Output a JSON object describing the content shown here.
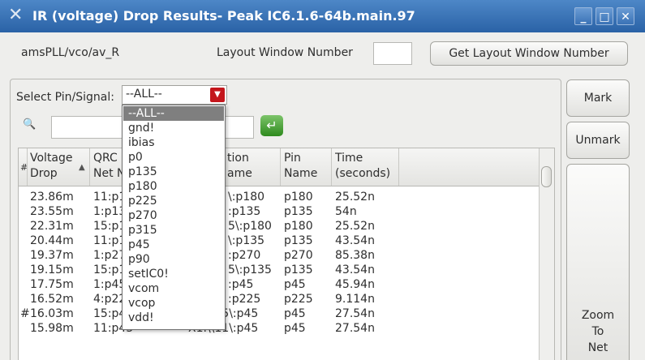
{
  "window": {
    "title": "IR (voltage) Drop Results- Peak IC6.1.6-64b.main.97",
    "minimize": "_",
    "maximize": "□",
    "close": "✕",
    "app_icon": "x-icon"
  },
  "header": {
    "path": "amsPLL/vco/av_R",
    "layout_window_label": "Layout Window Number",
    "layout_window_value": "",
    "get_layout_button": "Get Layout Window Number"
  },
  "filter": {
    "select_label": "Select Pin/Signal:",
    "selected": "--ALL--",
    "search_value": "",
    "search_icon": "magnifier-icon",
    "go_icon": "refresh-arrow-icon"
  },
  "dropdown": {
    "options": [
      "--ALL--",
      "gnd!",
      "ibias",
      "p0",
      "p135",
      "p180",
      "p225",
      "p270",
      "p315",
      "p45",
      "p90",
      "setIC0!",
      "vcom",
      "vcop",
      "vdd!"
    ]
  },
  "table": {
    "columns": [
      {
        "line1": "Voltage",
        "line2": "Drop"
      },
      {
        "line1": "QRC",
        "line2": "Net N"
      },
      {
        "line1": "tion",
        "line2": "ame"
      },
      {
        "line1": "Pin",
        "line2": "Name"
      },
      {
        "line1": "Time",
        "line2": "(seconds)"
      }
    ],
    "rows": [
      {
        "mark": "",
        "drop": "23.86m",
        "net": "11:p1",
        "inst": "\\:p180",
        "pin": "p180",
        "time": "25.52n"
      },
      {
        "mark": "",
        "drop": "23.55m",
        "net": "1:p13",
        "inst": ":p135",
        "pin": "p135",
        "time": "54n"
      },
      {
        "mark": "",
        "drop": "22.31m",
        "net": "15:p1",
        "inst": "5\\:p180",
        "pin": "p180",
        "time": "25.52n"
      },
      {
        "mark": "",
        "drop": "20.44m",
        "net": "11:p1",
        "inst": "\\:p135",
        "pin": "p135",
        "time": "43.54n"
      },
      {
        "mark": "",
        "drop": "19.37m",
        "net": "1:p27",
        "inst": ":p270",
        "pin": "p270",
        "time": "85.38n"
      },
      {
        "mark": "",
        "drop": "19.15m",
        "net": "15:p1",
        "inst": "5\\:p135",
        "pin": "p135",
        "time": "43.54n"
      },
      {
        "mark": "",
        "drop": "17.75m",
        "net": "1:p45",
        "inst": ":p45",
        "pin": "p45",
        "time": "45.94n"
      },
      {
        "mark": "",
        "drop": "16.52m",
        "net": "4:p22",
        "inst": ":p225",
        "pin": "p225",
        "time": "9.114n"
      },
      {
        "mark": "#",
        "drop": "16.03m",
        "net": "15:p4",
        "inst": "X1.\\\\15\\:p45",
        "pin": "p45",
        "time": "27.54n"
      },
      {
        "mark": "",
        "drop": "15.98m",
        "net": "11:p45",
        "inst": "X1.\\\\11\\:p45",
        "pin": "p45",
        "time": "27.54n"
      }
    ]
  },
  "side_buttons": {
    "mark": "Mark",
    "unmark": "Unmark",
    "zoom_line1": "Zoom",
    "zoom_line2": "To",
    "zoom_line3": "Net"
  }
}
